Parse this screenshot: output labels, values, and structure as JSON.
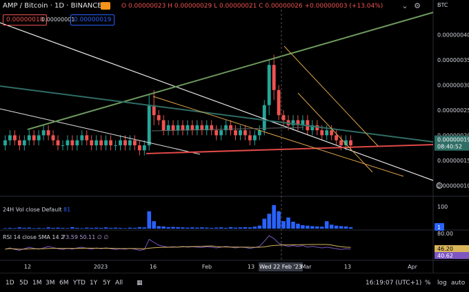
{
  "header": {
    "symbol": "AMP / Bitcoin · 1D · BINANCE",
    "ohlc_text": "O 0.00000023  H 0.00000029  L 0.00000021  C 0.00000026  +0.00000003 (+13.04%)",
    "sell_price": "0.00000018",
    "spread": "0.00000001",
    "buy_price": "0.00000019",
    "currency_tag": "BTC"
  },
  "colors": {
    "up": "#26a69a",
    "down": "#ef5350",
    "vol": "#2962ff",
    "rsi": "#7e57c2",
    "rsi_ma": "#d9b65a",
    "trend_white": "#e6e6e6",
    "trend_green": "#6e9a5e",
    "trend_orange": "#e0a64a",
    "trend_red": "#e04848",
    "teal": "#2f6e66"
  },
  "price_axis": {
    "labels": [
      "0.00000040",
      "0.00000035",
      "0.00000030",
      "0.00000025",
      "0.00000020",
      "0.00000015",
      "0.00000010"
    ],
    "current_price": "0.00000019",
    "countdown": "08:40:52"
  },
  "volume_panel": {
    "label": "24H Vol  close  Default",
    "value": "81",
    "scale_top": "100",
    "scale_current": "1"
  },
  "rsi_panel": {
    "label": "RSI 14 close SMA 14 2",
    "values": "73.59  50.11  ∅  ∅",
    "scale_top": "80.00",
    "rsi_value": "46.20",
    "ma_value": "40.62"
  },
  "time_axis": {
    "labels": [
      "12",
      "2023",
      "16",
      "Feb",
      "13",
      "Mar",
      "13",
      "Apr"
    ],
    "crosshair_label": "Wed 22 Feb '23"
  },
  "toolbar": {
    "timeframes": [
      "1D",
      "5D",
      "1M",
      "3M",
      "6M",
      "YTD",
      "1Y",
      "5Y",
      "All"
    ],
    "clock": "16:19:07 (UTC+1)",
    "pct": "%",
    "log": "log",
    "auto": "auto"
  },
  "chart_data": {
    "type": "candlestick",
    "title": "AMP / Bitcoin · 1D · BINANCE",
    "ylim": [
      8e-08,
      4.5e-07
    ],
    "candles": [
      [
        18,
        19,
        20,
        17
      ],
      [
        19,
        20,
        21,
        18
      ],
      [
        20,
        19,
        21,
        18
      ],
      [
        19,
        18,
        20,
        17
      ],
      [
        18,
        19,
        20,
        17
      ],
      [
        19,
        20,
        21,
        18
      ],
      [
        20,
        19,
        21,
        18
      ],
      [
        19,
        20,
        21,
        18
      ],
      [
        20,
        21,
        22,
        19
      ],
      [
        21,
        20,
        22,
        19
      ],
      [
        20,
        19,
        21,
        18
      ],
      [
        19,
        18,
        20,
        17
      ],
      [
        18,
        18,
        19,
        17
      ],
      [
        18,
        19,
        20,
        17
      ],
      [
        19,
        18,
        20,
        17
      ],
      [
        18,
        19,
        20,
        17
      ],
      [
        19,
        20,
        21,
        18
      ],
      [
        20,
        19,
        21,
        18
      ],
      [
        19,
        18,
        20,
        17
      ],
      [
        18,
        19,
        20,
        17
      ],
      [
        19,
        18,
        20,
        17
      ],
      [
        18,
        19,
        20,
        17
      ],
      [
        19,
        18,
        20,
        17
      ],
      [
        18,
        18,
        19,
        17
      ],
      [
        18,
        19,
        20,
        17
      ],
      [
        19,
        18,
        20,
        17
      ],
      [
        18,
        19,
        20,
        17
      ],
      [
        19,
        18,
        20,
        17
      ],
      [
        18,
        17,
        19,
        16
      ],
      [
        17,
        18,
        19,
        16
      ],
      [
        18,
        26,
        28,
        17
      ],
      [
        26,
        24,
        29,
        22
      ],
      [
        24,
        23,
        25,
        22
      ],
      [
        23,
        21,
        24,
        20
      ],
      [
        21,
        22,
        23,
        20
      ],
      [
        22,
        21,
        23,
        20
      ],
      [
        21,
        22,
        23,
        20
      ],
      [
        22,
        21,
        23,
        20
      ],
      [
        21,
        22,
        23,
        20
      ],
      [
        22,
        21,
        23,
        20
      ],
      [
        21,
        22,
        23,
        20
      ],
      [
        22,
        21,
        23,
        20
      ],
      [
        21,
        22,
        23,
        20
      ],
      [
        22,
        21,
        23,
        20
      ],
      [
        21,
        20,
        22,
        19
      ],
      [
        20,
        21,
        22,
        19
      ],
      [
        21,
        22,
        23,
        20
      ],
      [
        22,
        21,
        23,
        20
      ],
      [
        21,
        20,
        22,
        19
      ],
      [
        20,
        21,
        22,
        19
      ],
      [
        21,
        20,
        22,
        19
      ],
      [
        20,
        19,
        21,
        18
      ],
      [
        19,
        20,
        21,
        18
      ],
      [
        20,
        21,
        22,
        19
      ],
      [
        21,
        26,
        27,
        20
      ],
      [
        26,
        34,
        35,
        24
      ],
      [
        34,
        29,
        36,
        27
      ],
      [
        29,
        24,
        30,
        23
      ],
      [
        24,
        23,
        25,
        22
      ],
      [
        23,
        22,
        24,
        21
      ],
      [
        22,
        23,
        24,
        21
      ],
      [
        23,
        22,
        24,
        21
      ],
      [
        22,
        23,
        24,
        21
      ],
      [
        23,
        21,
        24,
        20
      ],
      [
        21,
        22,
        23,
        20
      ],
      [
        22,
        21,
        23,
        20
      ],
      [
        21,
        20,
        22,
        19
      ],
      [
        20,
        21,
        22,
        19
      ],
      [
        21,
        20,
        22,
        19
      ],
      [
        20,
        19,
        21,
        18
      ],
      [
        19,
        18,
        20,
        17
      ],
      [
        18,
        19,
        20,
        17
      ],
      [
        19,
        18,
        20,
        17
      ]
    ],
    "volume": [
      2,
      3,
      2,
      5,
      3,
      4,
      2,
      3,
      2,
      5,
      3,
      4,
      3,
      2,
      6,
      3,
      2,
      4,
      3,
      4,
      3,
      5,
      3,
      4,
      3,
      2,
      4,
      3,
      6,
      5,
      70,
      30,
      10,
      9,
      6,
      7,
      6,
      5,
      4,
      5,
      4,
      5,
      4,
      3,
      4,
      5,
      3,
      6,
      4,
      5,
      6,
      5,
      8,
      12,
      40,
      60,
      95,
      70,
      30,
      45,
      28,
      20,
      14,
      12,
      10,
      9,
      8,
      30,
      16,
      12,
      10,
      9,
      6
    ],
    "rsi": [
      45,
      48,
      44,
      42,
      46,
      50,
      47,
      45,
      48,
      52,
      49,
      46,
      44,
      47,
      45,
      48,
      50,
      47,
      45,
      48,
      46,
      48,
      46,
      44,
      46,
      45,
      47,
      45,
      42,
      44,
      70,
      62,
      55,
      52,
      50,
      51,
      50,
      52,
      50,
      51,
      50,
      49,
      51,
      50,
      48,
      50,
      52,
      50,
      48,
      50,
      49,
      47,
      49,
      52,
      65,
      79,
      72,
      60,
      55,
      52,
      54,
      52,
      54,
      50,
      52,
      50,
      48,
      50,
      48,
      46,
      44,
      46,
      45
    ],
    "x_axis_labels": [
      "12",
      "2023",
      "16",
      "Feb",
      "13",
      "Mar",
      "13",
      "Apr"
    ]
  }
}
